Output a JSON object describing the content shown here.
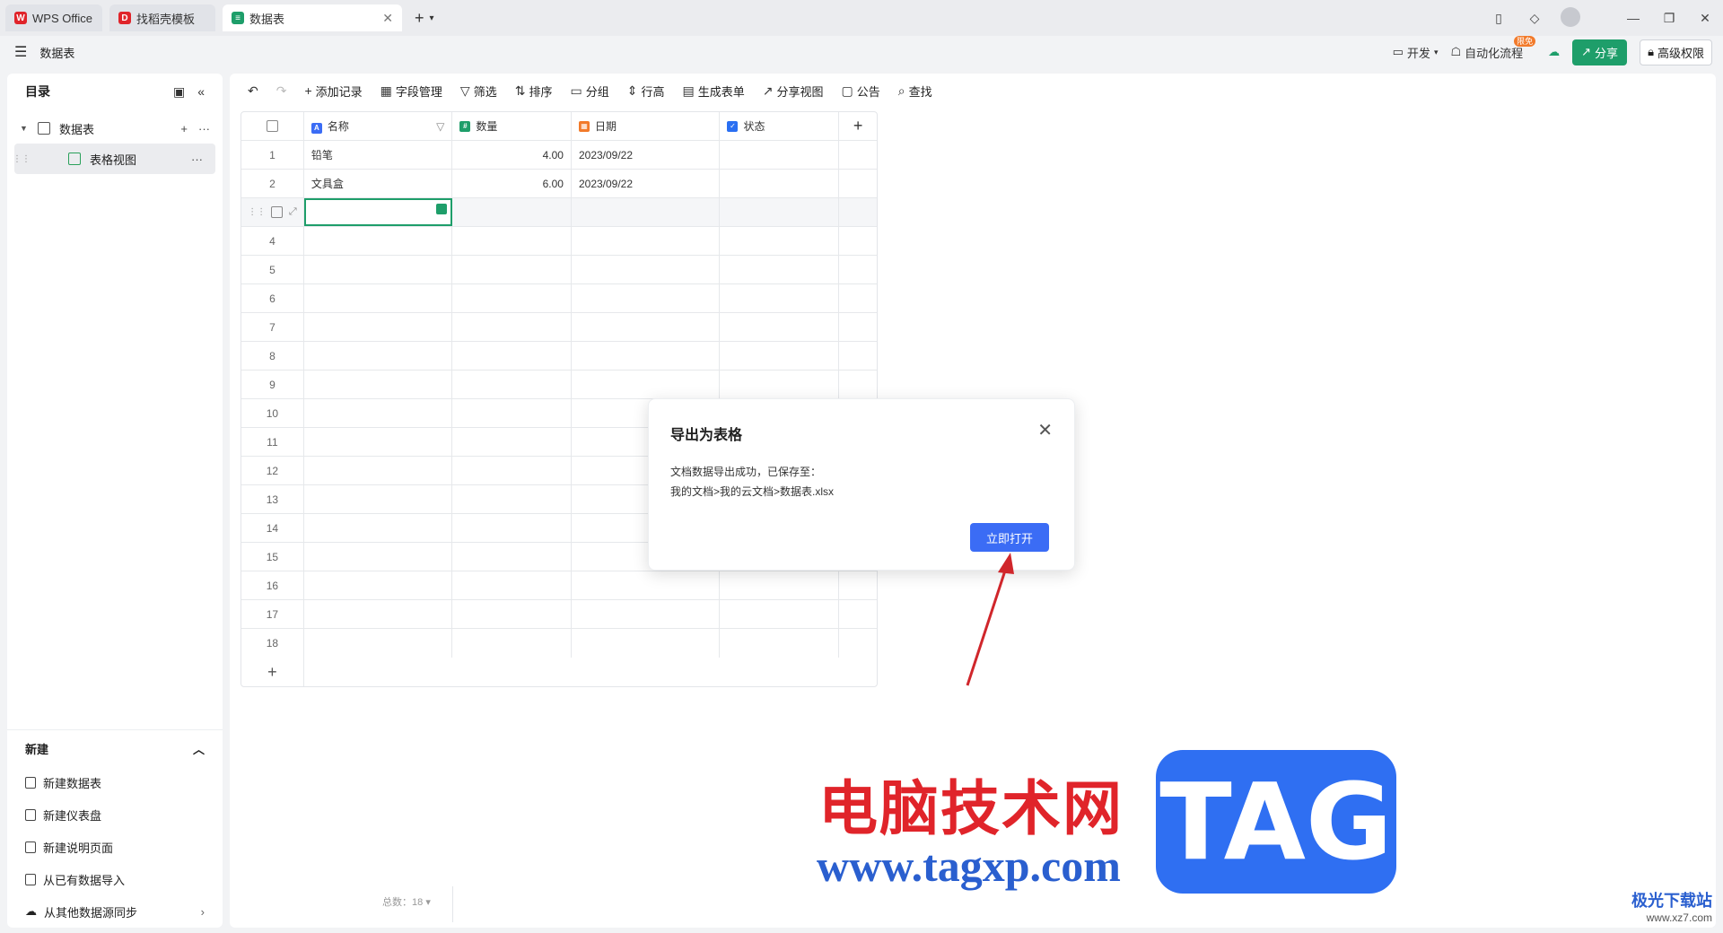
{
  "tabs": [
    {
      "label": "WPS Office",
      "icon": "wps-logo-icon"
    },
    {
      "label": "找稻壳模板",
      "icon": "docer-icon"
    },
    {
      "label": "数据表",
      "icon": "datasheet-icon"
    }
  ],
  "app": {
    "doc_title": "数据表",
    "actions": {
      "dev": "开发",
      "automation": "自动化流程",
      "automation_badge": "限免",
      "share": "分享",
      "permission": "高级权限"
    }
  },
  "sidebar": {
    "header": "目录",
    "tree": {
      "table": "数据表",
      "view": "表格视图"
    },
    "new_section": {
      "title": "新建",
      "items": [
        "新建数据表",
        "新建仪表盘",
        "新建说明页面",
        "从已有数据导入",
        "从其他数据源同步"
      ]
    }
  },
  "toolbar": {
    "items": [
      "添加记录",
      "字段管理",
      "筛选",
      "排序",
      "分组",
      "行高",
      "生成表单",
      "分享视图",
      "公告",
      "查找"
    ]
  },
  "grid": {
    "columns": [
      "名称",
      "数量",
      "日期",
      "状态"
    ],
    "rows": [
      {
        "num": "1",
        "name": "铅笔",
        "qty": "4.00",
        "date": "2023/09/22",
        "status": ""
      },
      {
        "num": "2",
        "name": "文具盒",
        "qty": "6.00",
        "date": "2023/09/22",
        "status": ""
      }
    ],
    "empty_rows": [
      "4",
      "5",
      "6",
      "7",
      "8",
      "9",
      "10",
      "11",
      "12",
      "13",
      "14",
      "15",
      "16",
      "17",
      "18"
    ],
    "total_label": "总数：18"
  },
  "dialog": {
    "title": "导出为表格",
    "message_line1": "文档数据导出成功，已保存至：",
    "message_line2": "我的文档>我的云文档>数据表.xlsx",
    "button": "立即打开"
  },
  "watermark": {
    "cn": "电脑技术网",
    "url": "www.tagxp.com",
    "tag": "TAG",
    "corner": "极光下载站",
    "corner_url": "www.xz7.com"
  },
  "colors": {
    "accent_green": "#1e9e6a",
    "dialog_button": "#3b6cf5",
    "arrow": "#d0262b"
  }
}
